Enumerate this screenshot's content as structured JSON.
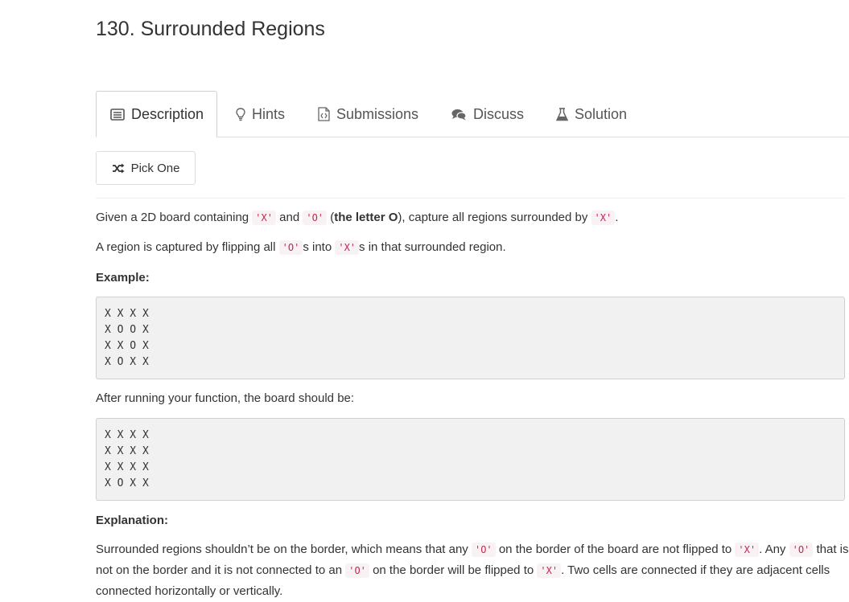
{
  "title": "130. Surrounded Regions",
  "tabs": [
    {
      "label": "Description",
      "icon": "list-icon"
    },
    {
      "label": "Hints",
      "icon": "lightbulb-icon"
    },
    {
      "label": "Submissions",
      "icon": "code-file-icon"
    },
    {
      "label": "Discuss",
      "icon": "comments-icon"
    },
    {
      "label": "Solution",
      "icon": "flask-icon"
    }
  ],
  "pick_one": "Pick One",
  "para1": {
    "t1": "Given a 2D board containing ",
    "c1": "'X'",
    "t2": " and ",
    "c2": "'O'",
    "t3": " (",
    "b": "the letter O",
    "t4": "), capture all regions surrounded by ",
    "c3": "'X'",
    "t5": "."
  },
  "para2": {
    "t1": "A region is captured by flipping all ",
    "c1": "'O'",
    "t2": "s into ",
    "c2": "'X'",
    "t3": "s in that surrounded region."
  },
  "example_label": "Example:",
  "example_board": [
    "X X X X",
    "X O O X",
    "X X O X",
    "X O X X"
  ],
  "after_text": "After running your function, the board should be:",
  "result_board": [
    "X X X X",
    "X X X X",
    "X X X X",
    "X O X X"
  ],
  "explanation_label": "Explanation:",
  "explanation": {
    "t1": "Surrounded regions shouldn’t be on the border, which means that any ",
    "c1": "'O'",
    "t2": " on the border of the board are not flipped to ",
    "c2": "'X'",
    "t3": ". Any ",
    "c3": "'O'",
    "t4": " that is not on the border and it is not connected to an ",
    "c4": "'O'",
    "t5": " on the border will be flipped to ",
    "c5": "'X'",
    "t6": ". Two cells are connected if they are adjacent cells connected horizontally or vertically."
  },
  "colors": {
    "code_text": "#c7254e",
    "code_bg": "#f9f2f4",
    "pre_bg": "#f1f1f1"
  }
}
